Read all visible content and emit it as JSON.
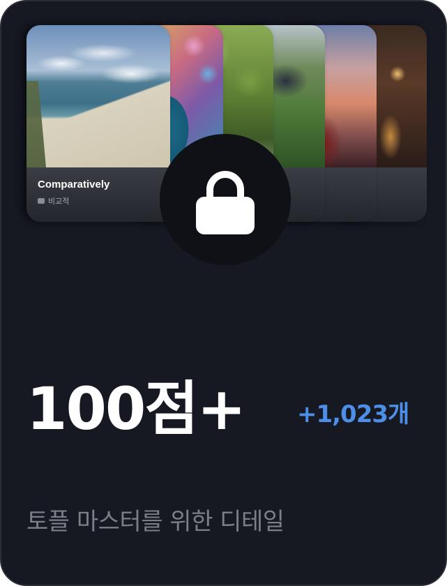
{
  "card": {
    "preview_card": {
      "word": "Comparatively",
      "translation": "비교적"
    },
    "lock": {
      "icon": "lock-icon"
    },
    "score": "100점+",
    "delta": "+1,023개",
    "description": "토플 마스터를 위한 디테일"
  },
  "colors": {
    "background": "#161822",
    "accent": "#4d8fe6",
    "text_primary": "#ffffff",
    "text_secondary": "#7c7f88"
  }
}
